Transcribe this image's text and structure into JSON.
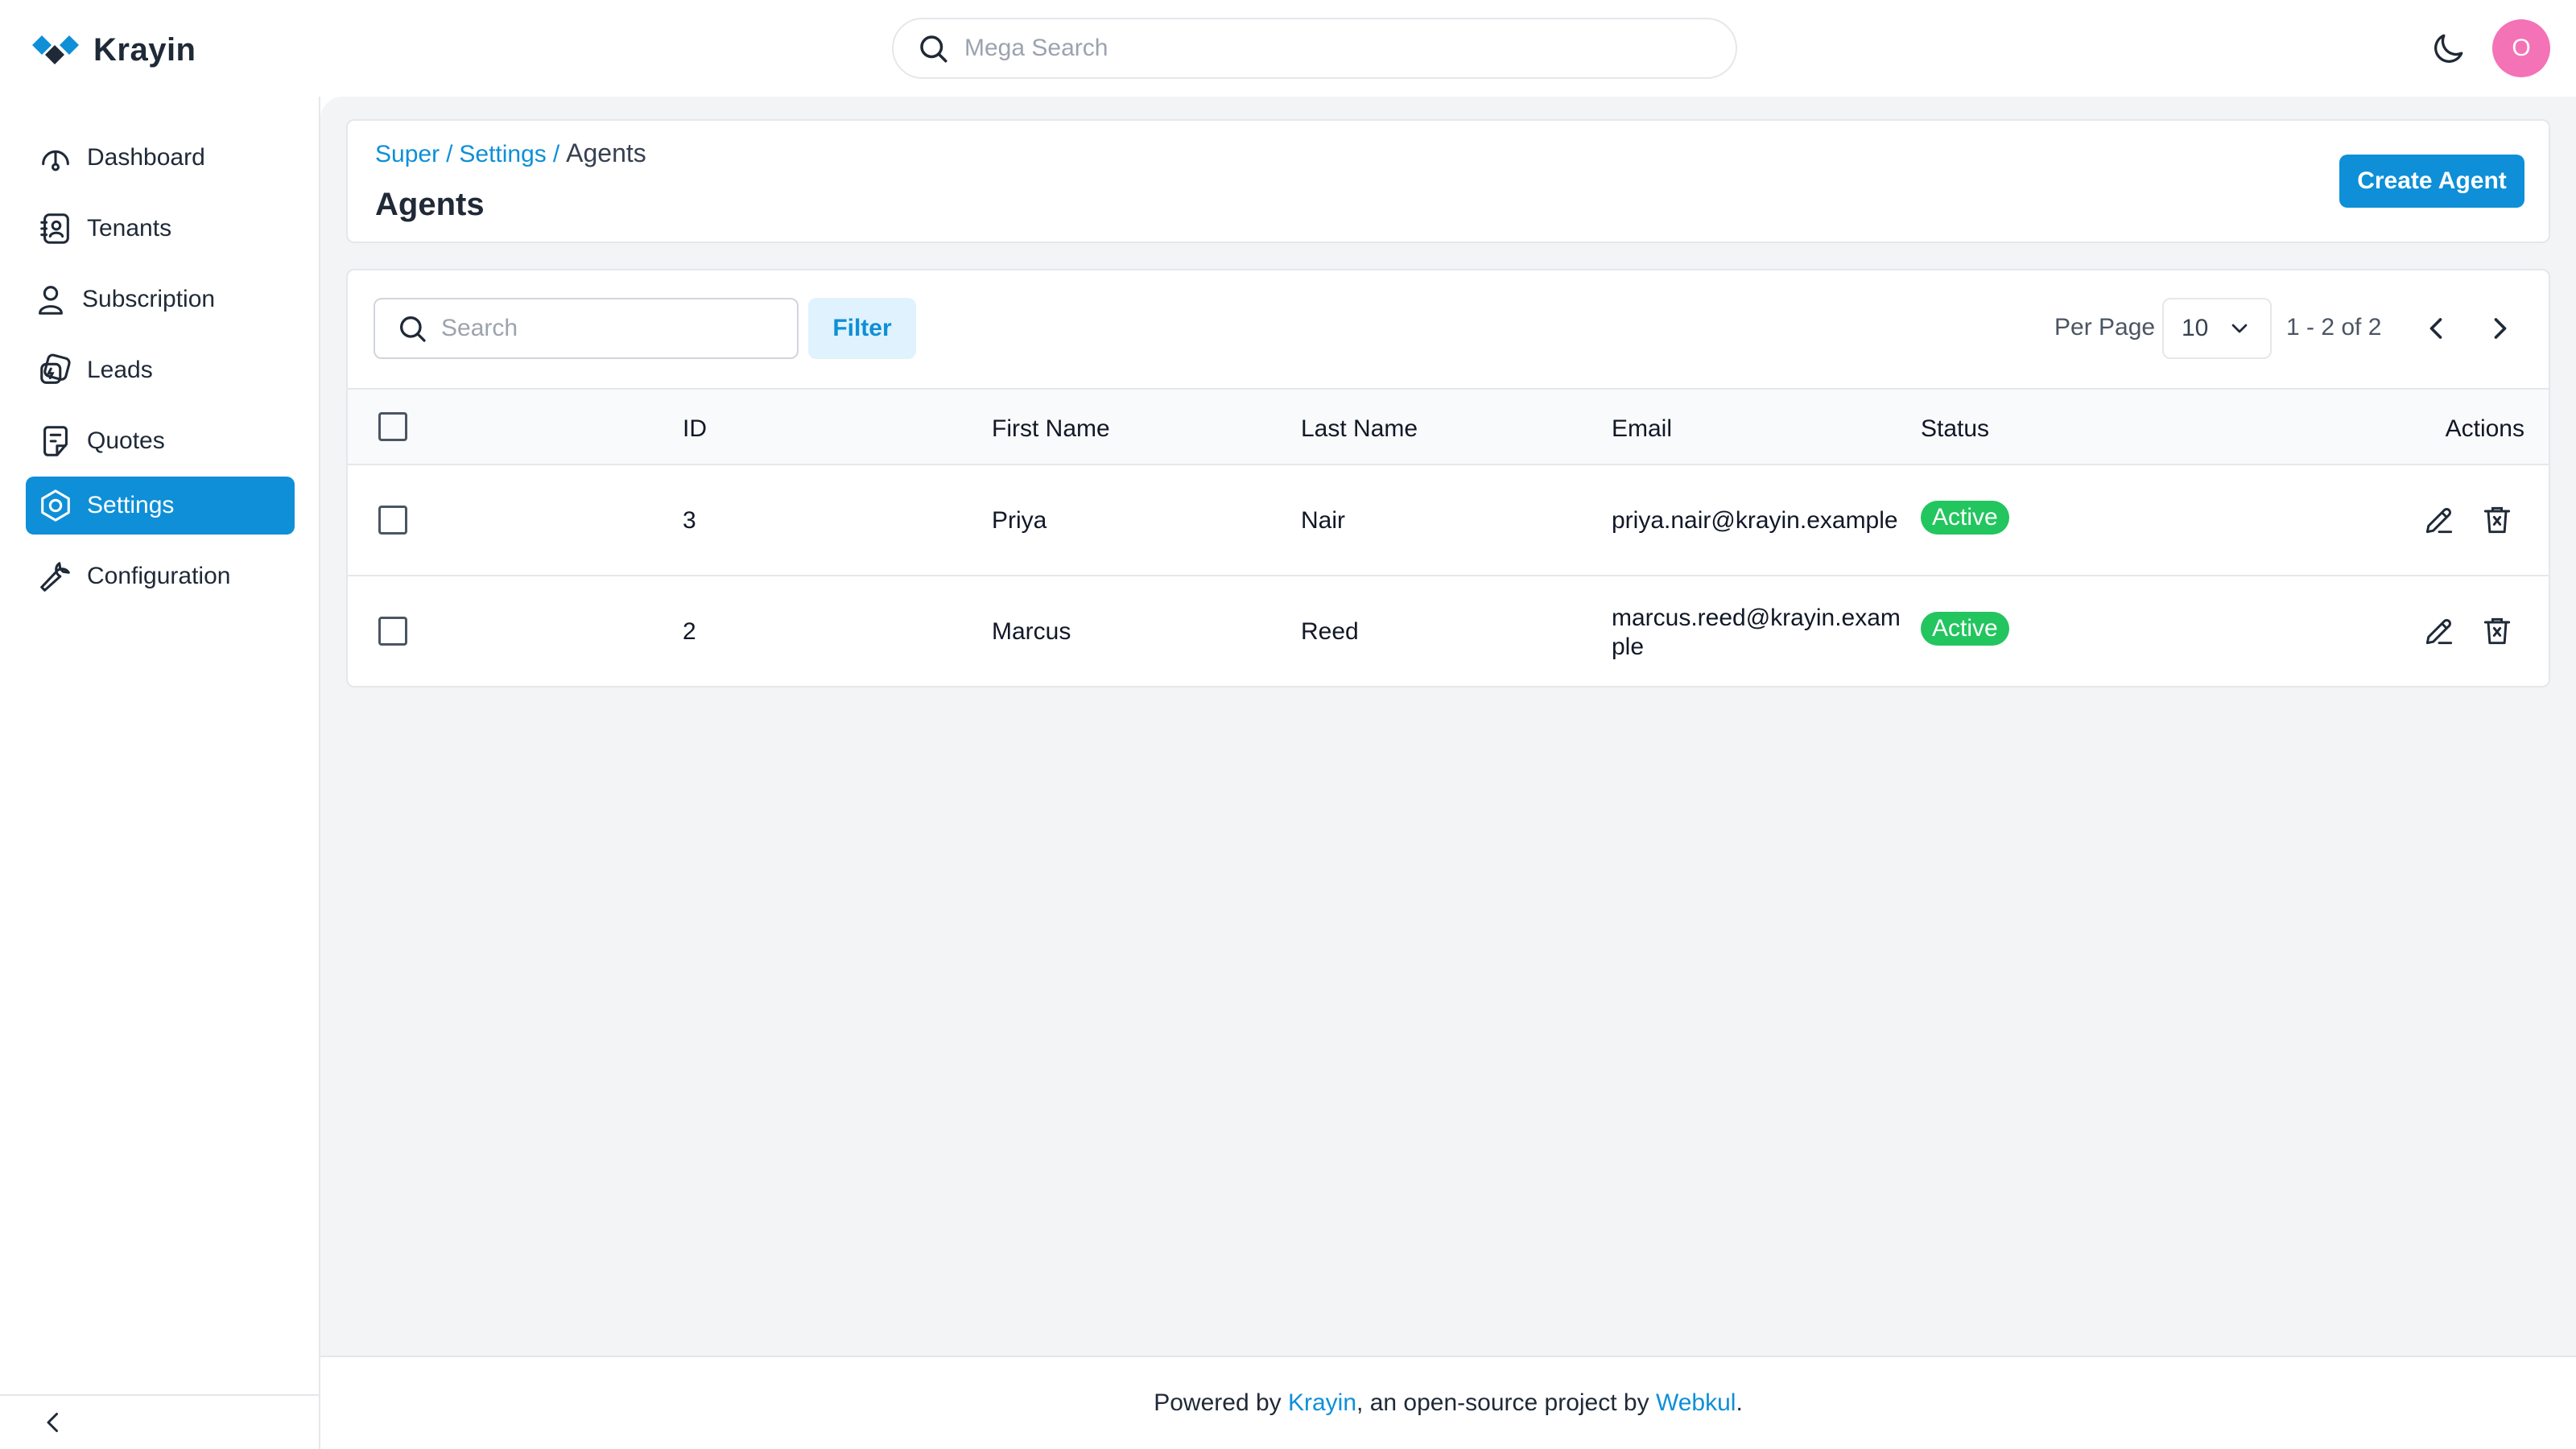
{
  "app": {
    "name": "Krayin",
    "brand_color": "#0e8fd8",
    "mega_search_placeholder": "Mega Search",
    "avatar_initial": "O"
  },
  "sidebar": {
    "items": [
      {
        "label": "Dashboard",
        "icon": "dashboard-icon",
        "active": false
      },
      {
        "label": "Tenants",
        "icon": "tenants-icon",
        "active": false
      },
      {
        "label": "Subscription",
        "icon": "user-icon",
        "active": false
      },
      {
        "label": "Leads",
        "icon": "leads-icon",
        "active": false
      },
      {
        "label": "Quotes",
        "icon": "quotes-icon",
        "active": false
      },
      {
        "label": "Settings",
        "icon": "settings-icon",
        "active": true
      },
      {
        "label": "Configuration",
        "icon": "wrench-icon",
        "active": false
      }
    ]
  },
  "header": {
    "breadcrumb": [
      "Super",
      "Settings",
      "Agents"
    ],
    "breadcrumb_sep": "/",
    "title": "Agents",
    "create_button": "Create Agent"
  },
  "toolbar": {
    "search_placeholder": "Search",
    "filter_label": "Filter",
    "per_page_label": "Per Page",
    "per_page_value": "10",
    "pagination_info": "1 - 2 of 2"
  },
  "table": {
    "columns": [
      "ID",
      "First Name",
      "Last Name",
      "Email",
      "Status",
      "Actions"
    ],
    "rows": [
      {
        "id": "3",
        "first_name": "Priya",
        "last_name": "Nair",
        "email": "priya.nair@krayin.example",
        "status": "Active"
      },
      {
        "id": "2",
        "first_name": "Marcus",
        "last_name": "Reed",
        "email": "marcus.reed@krayin.example",
        "status": "Active"
      }
    ],
    "status_color": "#22c55e"
  },
  "footer": {
    "prefix": "Powered by ",
    "krayin_link": "Krayin",
    "middle": ", an open-source project by ",
    "webkul_link": "Webkul",
    "suffix": "."
  }
}
